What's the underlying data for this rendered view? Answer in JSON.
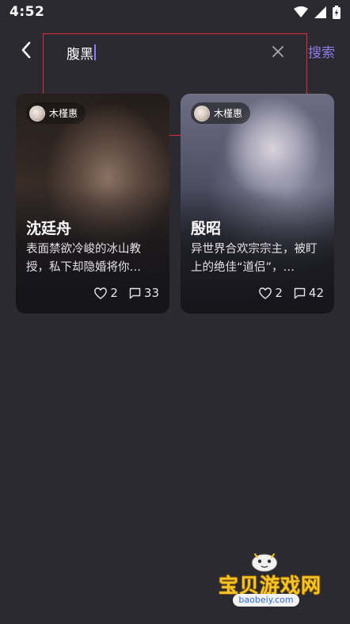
{
  "status_bar": {
    "time": "4:52",
    "icons": [
      "wifi-icon",
      "signal-icon",
      "battery-charging-icon"
    ]
  },
  "search": {
    "back_icon": "chevron-left-icon",
    "query": "腹黑",
    "clear_icon": "close-icon",
    "search_label": "搜索"
  },
  "results": [
    {
      "author": "木槿惠",
      "title": "沈廷舟",
      "description": "表面禁欲冷峻的冰山教授，私下却隐婚将你…",
      "likes": "2",
      "comments": "33"
    },
    {
      "author": "木槿惠",
      "title": "殷昭",
      "description": "异世界合欢宗宗主，被盯上的绝佳“道侣”，…",
      "likes": "2",
      "comments": "42"
    }
  ],
  "watermark": {
    "text": "宝贝游戏网",
    "url": "baobeiy.com"
  },
  "colors": {
    "background": "#2a2a30",
    "accent": "#8e7be8",
    "highlight_box": "#e0303a",
    "watermark_gold": "#f5c52a"
  }
}
